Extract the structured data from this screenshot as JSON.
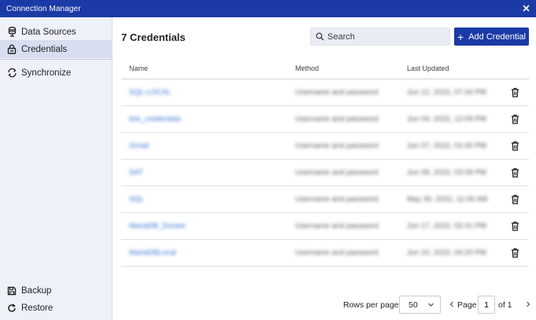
{
  "window": {
    "title": "Connection Manager",
    "close_icon": "close-icon"
  },
  "sidebar": {
    "items": [
      {
        "label": "Data Sources",
        "icon": "database-icon"
      },
      {
        "label": "Credentials",
        "icon": "lock-icon",
        "active": true
      },
      {
        "label": "Synchronize",
        "icon": "sync-icon"
      }
    ],
    "bottom_items": [
      {
        "label": "Backup",
        "icon": "save-icon"
      },
      {
        "label": "Restore",
        "icon": "restore-icon"
      }
    ]
  },
  "main": {
    "title": "7 Credentials",
    "search": {
      "placeholder": "Search",
      "value": ""
    },
    "add_button": {
      "label": "Add Credential"
    },
    "table": {
      "columns": [
        "Name",
        "Method",
        "Last Updated"
      ],
      "rows": [
        {
          "name": "SQL-LOCAL",
          "method": "Username and password",
          "updated": "Jun 12, 2022, 07:44 PM"
        },
        {
          "name": "bck_credentials",
          "method": "Username and password",
          "updated": "Jun 04, 2022, 12:09 PM"
        },
        {
          "name": "Gmail",
          "method": "Username and password",
          "updated": "Jun 07, 2022, 01:40 PM"
        },
        {
          "name": "SAT",
          "method": "Username and password",
          "updated": "Jun 09, 2022, 03:39 PM"
        },
        {
          "name": "SQL",
          "method": "Username and password",
          "updated": "May 30, 2022, 11:06 AM"
        },
        {
          "name": "MariaDB_Docker",
          "method": "Username and password",
          "updated": "Jun 17, 2022, 02:41 PM"
        },
        {
          "name": "MariaDBLocal",
          "method": "Username and password",
          "updated": "Jun 10, 2022, 04:20 PM"
        }
      ]
    },
    "pagination": {
      "rows_per_page_label": "Rows per page:",
      "rows_per_page_value": "50",
      "page_label": "Page",
      "page_value": "1",
      "of_label": "of 1"
    }
  },
  "colors": {
    "accent": "#1b3aa6",
    "sidebar_bg": "#eef1f8",
    "link": "#2e6fd1"
  }
}
